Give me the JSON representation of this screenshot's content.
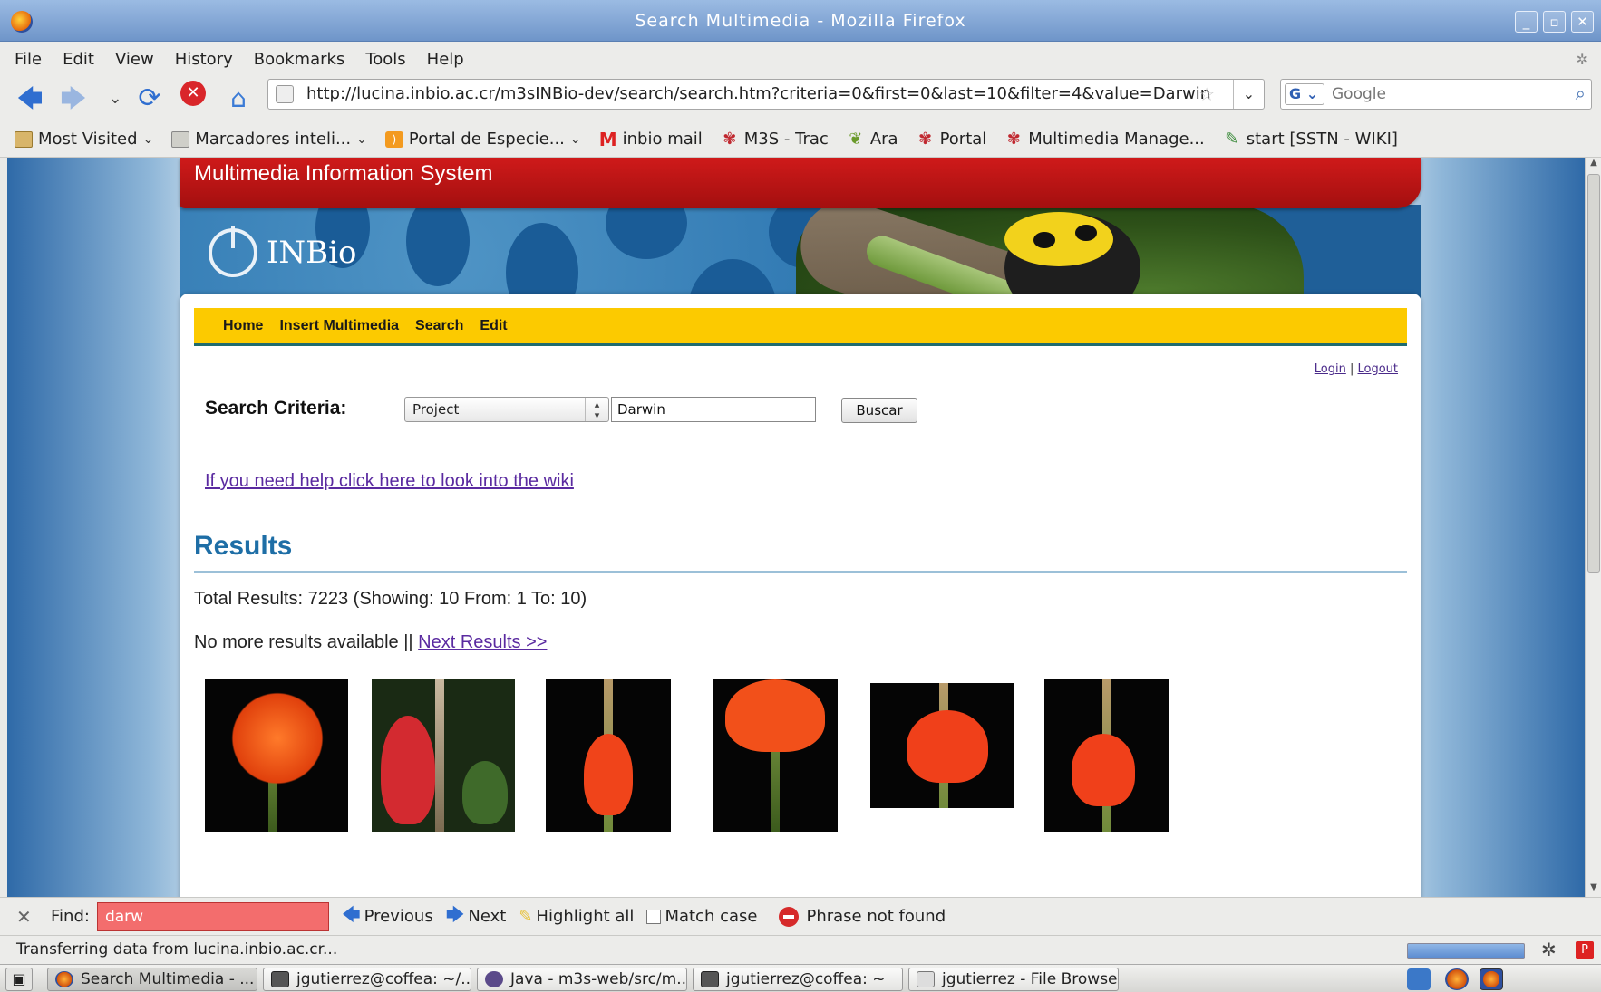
{
  "window": {
    "title": "Search Multimedia - Mozilla Firefox",
    "buttons": [
      "_",
      "▫",
      "✕"
    ]
  },
  "menu": [
    "File",
    "Edit",
    "View",
    "History",
    "Bookmarks",
    "Tools",
    "Help"
  ],
  "nav": {
    "url": "http://lucina.inbio.ac.cr/m3sINBio-dev/search/search.htm?criteria=0&first=0&last=10&filter=4&value=Darwin",
    "search_engine": "G",
    "search_placeholder": "Google"
  },
  "bookmarks": [
    {
      "label": "Most Visited",
      "icon": "folder-icon",
      "dropdown": true
    },
    {
      "label": "Marcadores inteli...",
      "icon": "smart-folder-icon",
      "dropdown": true
    },
    {
      "label": "Portal de Especie...",
      "icon": "rss-icon",
      "dropdown": true
    },
    {
      "label": "inbio mail",
      "icon": "gmail-icon",
      "dropdown": false
    },
    {
      "label": "M3S - Trac",
      "icon": "paw-icon",
      "dropdown": false
    },
    {
      "label": "Ara",
      "icon": "leaf-icon",
      "dropdown": false
    },
    {
      "label": "Portal",
      "icon": "paw-icon",
      "dropdown": false
    },
    {
      "label": "Multimedia Manage...",
      "icon": "paw-icon",
      "dropdown": false
    },
    {
      "label": "start [SSTN - WIKI]",
      "icon": "wiki-icon",
      "dropdown": false
    }
  ],
  "page": {
    "site_title": "Multimedia Information System",
    "logo_text": "INBio",
    "nav_links": [
      "Home",
      "Insert Multimedia",
      "Search",
      "Edit"
    ],
    "login": "Login",
    "login_sep": "|",
    "logout": "Logout",
    "criteria_label": "Search Criteria:",
    "criteria_select": "Project",
    "criteria_value": "Darwin",
    "search_button": "Buscar",
    "help_link": "If you need help click here to look into the wiki",
    "results_heading": "Results",
    "total_results": "Total Results: 7223 (Showing: 10 From: 1 To: 10)",
    "no_more": "No more results available || ",
    "next_results": "Next Results >>",
    "thumbnails": [
      "flower-photo-1",
      "flower-photo-2",
      "flower-photo-3",
      "flower-photo-4",
      "flower-photo-5",
      "flower-photo-6"
    ]
  },
  "findbar": {
    "label": "Find:",
    "value": "darw",
    "previous": "Previous",
    "next": "Next",
    "highlight_all": "Highlight all",
    "match_case": "Match case",
    "status": "Phrase not found"
  },
  "status": {
    "message": "Transferring data from lucina.inbio.ac.cr..."
  },
  "taskbar": {
    "tasks": [
      "Search Multimedia - ...",
      "jgutierrez@coffea: ~/...",
      "Java - m3s-web/src/m...",
      "jgutierrez@coffea: ~",
      "jgutierrez - File Browser"
    ]
  },
  "colors": {
    "site_red": "#c01515",
    "nav_yellow": "#fcca00",
    "results_blue": "#1e6ea6",
    "link_purple": "#5a2aa0",
    "find_not_found": "#f36d6d"
  }
}
